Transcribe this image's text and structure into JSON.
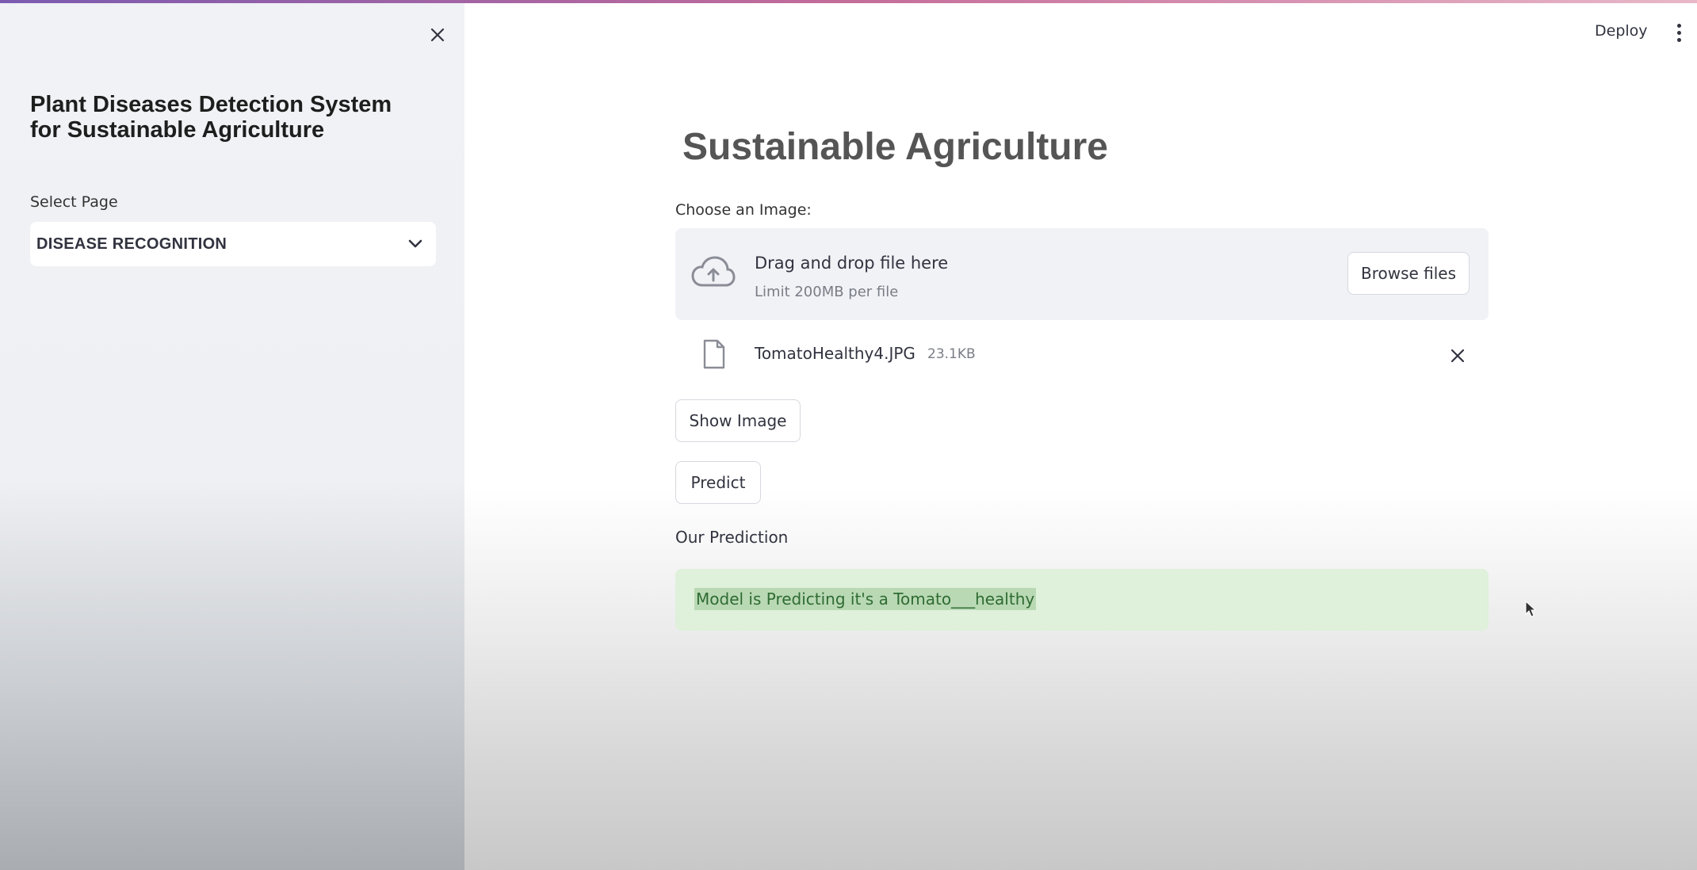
{
  "sidebar": {
    "title": "Plant Diseases Detection System for Sustainable Agriculture",
    "select_label": "Select Page",
    "select_value": "DISEASE RECOGNITION"
  },
  "header": {
    "deploy_label": "Deploy"
  },
  "main": {
    "title": "Sustainable Agriculture",
    "uploader": {
      "label": "Choose an Image:",
      "drop_title": "Drag and drop file here",
      "drop_limit": "Limit 200MB per file",
      "browse_label": "Browse files"
    },
    "file": {
      "name": "TomatoHealthy4.JPG",
      "size": "23.1KB"
    },
    "show_image_label": "Show Image",
    "predict_label": "Predict",
    "prediction_label": "Our Prediction",
    "prediction_text": "Model is Predicting it's a Tomato___healthy"
  },
  "colors": {
    "success_bg": "#dff0db",
    "success_text": "#2f6b33",
    "sidebar_bg": "#f0f2f6"
  },
  "icons": [
    "close-icon",
    "chevron-down-icon",
    "more-vert-icon",
    "cloud-upload-icon",
    "file-icon",
    "close-icon",
    "cursor-icon"
  ]
}
